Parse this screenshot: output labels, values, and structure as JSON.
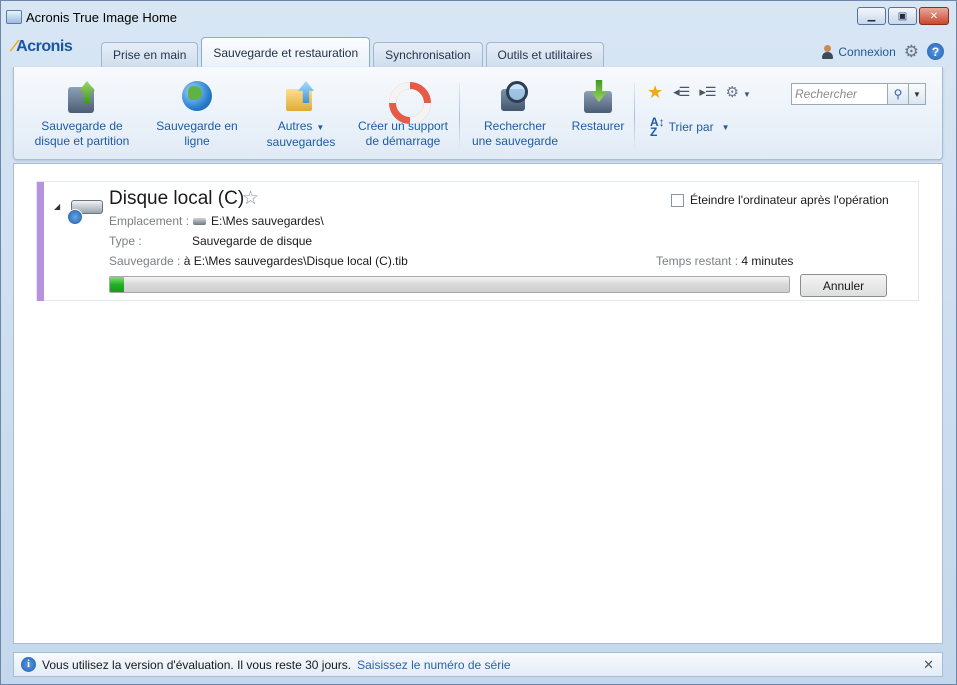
{
  "window": {
    "title": "Acronis True Image Home",
    "minimize_icon": "minimize-icon",
    "maximize_icon": "maximize-icon",
    "close_icon": "close-icon"
  },
  "header": {
    "logo": "Acronis",
    "tabs": [
      {
        "label": "Prise en main",
        "active": false
      },
      {
        "label": "Sauvegarde et restauration",
        "active": true
      },
      {
        "label": "Synchronisation",
        "active": false
      },
      {
        "label": "Outils et utilitaires",
        "active": false
      }
    ],
    "connexion_label": "Connexion"
  },
  "toolbar": {
    "items": [
      {
        "label_line1": "Sauvegarde de",
        "label_line2": "disque et partition",
        "icon": "disk-backup-icon"
      },
      {
        "label_line1": "Sauvegarde en",
        "label_line2": "ligne",
        "icon": "globe-icon"
      },
      {
        "label_line1": "Autres",
        "label_line2": "sauvegardes",
        "icon": "folder-backup-icon"
      },
      {
        "label_line1": "Créer un support",
        "label_line2": "de démarrage",
        "icon": "lifebuoy-icon"
      },
      {
        "label_line1": "Rechercher",
        "label_line2": "une sauvegarde",
        "icon": "search-backup-icon"
      },
      {
        "label_line1": "Restaurer",
        "label_line2": "",
        "icon": "restore-icon"
      }
    ],
    "sort_label": "Trier par",
    "search_placeholder": "Rechercher"
  },
  "task": {
    "title": "Disque local (C)",
    "location_label": "Emplacement :",
    "location_value": "E:\\Mes sauvegardes\\",
    "type_label": "Type :",
    "type_value": "Sauvegarde de disque",
    "backup_label": "Sauvegarde :",
    "backup_value": "à E:\\Mes sauvegardes\\Disque local (C).tib",
    "remaining_label": "Temps restant :",
    "remaining_value": "4 minutes",
    "shutdown_label": "Éteindre l'ordinateur après l'opération",
    "shutdown_checked": false,
    "progress_fraction": 0.02,
    "cancel_label": "Annuler",
    "accent_color": "#b891e0"
  },
  "statusbar": {
    "message": "Vous utilisez la version d'évaluation. Il vous reste 30 jours.",
    "link": "Saisissez le numéro de série"
  }
}
